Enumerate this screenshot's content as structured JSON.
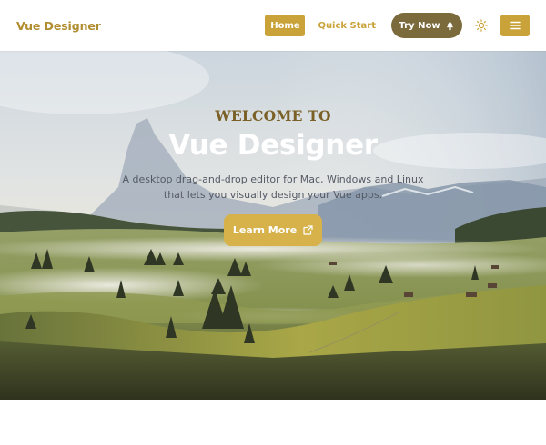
{
  "header": {
    "logo": "Vue Designer",
    "nav": {
      "home": "Home",
      "quick_start": "Quick Start",
      "try_now": "Try Now"
    },
    "icons": {
      "try_now": "tree-icon",
      "theme": "sun-icon",
      "menu": "hamburger-menu-icon"
    }
  },
  "hero": {
    "eyebrow": "WELCOME TO",
    "title": "Vue Designer",
    "description_line1": "A desktop drag-and-drop editor for Mac, Windows and Linux",
    "description_line2": "that lets you visually design your Vue apps.",
    "cta_label": "Learn More",
    "cta_icon": "external-link-icon",
    "background": "misty-alpine-meadow-photo"
  },
  "colors": {
    "brand_gold": "#c9a33a",
    "cta_gold": "#d7b24a",
    "try_now_olive": "#7a6a3c",
    "eyebrow_brown": "#7a6026"
  }
}
